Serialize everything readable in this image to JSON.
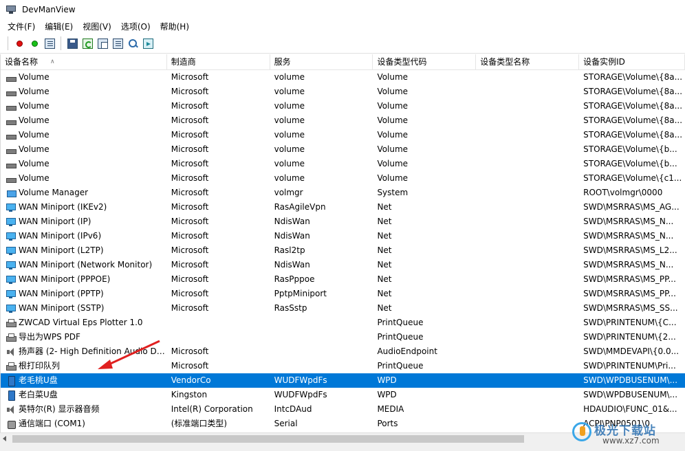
{
  "window": {
    "title": "DevManView"
  },
  "menu": [
    "文件(F)",
    "编辑(E)",
    "视图(V)",
    "选项(O)",
    "帮助(H)"
  ],
  "columns": [
    "设备名称",
    "制造商",
    "服务",
    "设备类型代码",
    "设备类型名称",
    "设备实例ID"
  ],
  "rows": [
    {
      "icon": "drive-icon",
      "name": "Volume",
      "manufacturer": "Microsoft",
      "service": "volume",
      "class": "Volume",
      "class_name": "",
      "instance_id": "STORAGE\\Volume\\{8a..."
    },
    {
      "icon": "drive-icon",
      "name": "Volume",
      "manufacturer": "Microsoft",
      "service": "volume",
      "class": "Volume",
      "class_name": "",
      "instance_id": "STORAGE\\Volume\\{8a..."
    },
    {
      "icon": "drive-icon",
      "name": "Volume",
      "manufacturer": "Microsoft",
      "service": "volume",
      "class": "Volume",
      "class_name": "",
      "instance_id": "STORAGE\\Volume\\{8a..."
    },
    {
      "icon": "drive-icon",
      "name": "Volume",
      "manufacturer": "Microsoft",
      "service": "volume",
      "class": "Volume",
      "class_name": "",
      "instance_id": "STORAGE\\Volume\\{8a..."
    },
    {
      "icon": "drive-icon",
      "name": "Volume",
      "manufacturer": "Microsoft",
      "service": "volume",
      "class": "Volume",
      "class_name": "",
      "instance_id": "STORAGE\\Volume\\{8a..."
    },
    {
      "icon": "drive-icon",
      "name": "Volume",
      "manufacturer": "Microsoft",
      "service": "volume",
      "class": "Volume",
      "class_name": "",
      "instance_id": "STORAGE\\Volume\\{b..."
    },
    {
      "icon": "drive-icon",
      "name": "Volume",
      "manufacturer": "Microsoft",
      "service": "volume",
      "class": "Volume",
      "class_name": "",
      "instance_id": "STORAGE\\Volume\\{b..."
    },
    {
      "icon": "drive-icon",
      "name": "Volume",
      "manufacturer": "Microsoft",
      "service": "volume",
      "class": "Volume",
      "class_name": "",
      "instance_id": "STORAGE\\Volume\\{c1..."
    },
    {
      "icon": "system-device-icon",
      "name": "Volume Manager",
      "manufacturer": "Microsoft",
      "service": "volmgr",
      "class": "System",
      "class_name": "",
      "instance_id": "ROOT\\volmgr\\0000"
    },
    {
      "icon": "network-adapter-icon",
      "name": "WAN Miniport (IKEv2)",
      "manufacturer": "Microsoft",
      "service": "RasAgileVpn",
      "class": "Net",
      "class_name": "",
      "instance_id": "SWD\\MSRRAS\\MS_AG..."
    },
    {
      "icon": "network-adapter-icon",
      "name": "WAN Miniport (IP)",
      "manufacturer": "Microsoft",
      "service": "NdisWan",
      "class": "Net",
      "class_name": "",
      "instance_id": "SWD\\MSRRAS\\MS_N..."
    },
    {
      "icon": "network-adapter-icon",
      "name": "WAN Miniport (IPv6)",
      "manufacturer": "Microsoft",
      "service": "NdisWan",
      "class": "Net",
      "class_name": "",
      "instance_id": "SWD\\MSRRAS\\MS_N..."
    },
    {
      "icon": "network-adapter-icon",
      "name": "WAN Miniport (L2TP)",
      "manufacturer": "Microsoft",
      "service": "Rasl2tp",
      "class": "Net",
      "class_name": "",
      "instance_id": "SWD\\MSRRAS\\MS_L2..."
    },
    {
      "icon": "network-adapter-icon",
      "name": "WAN Miniport (Network Monitor)",
      "manufacturer": "Microsoft",
      "service": "NdisWan",
      "class": "Net",
      "class_name": "",
      "instance_id": "SWD\\MSRRAS\\MS_N..."
    },
    {
      "icon": "network-adapter-icon",
      "name": "WAN Miniport (PPPOE)",
      "manufacturer": "Microsoft",
      "service": "RasPppoe",
      "class": "Net",
      "class_name": "",
      "instance_id": "SWD\\MSRRAS\\MS_PP..."
    },
    {
      "icon": "network-adapter-icon",
      "name": "WAN Miniport (PPTP)",
      "manufacturer": "Microsoft",
      "service": "PptpMiniport",
      "class": "Net",
      "class_name": "",
      "instance_id": "SWD\\MSRRAS\\MS_PP..."
    },
    {
      "icon": "network-adapter-icon",
      "name": "WAN Miniport (SSTP)",
      "manufacturer": "Microsoft",
      "service": "RasSstp",
      "class": "Net",
      "class_name": "",
      "instance_id": "SWD\\MSRRAS\\MS_SS..."
    },
    {
      "icon": "printer-icon",
      "name": "ZWCAD Virtual Eps Plotter 1.0",
      "manufacturer": "",
      "service": "",
      "class": "PrintQueue",
      "class_name": "",
      "instance_id": "SWD\\PRINTENUM\\{C..."
    },
    {
      "icon": "printer-icon",
      "name": "导出为WPS PDF",
      "manufacturer": "",
      "service": "",
      "class": "PrintQueue",
      "class_name": "",
      "instance_id": "SWD\\PRINTENUM\\{2..."
    },
    {
      "icon": "speaker-icon",
      "name": "扬声器 (2- High Definition Audio De...",
      "manufacturer": "Microsoft",
      "service": "",
      "class": "AudioEndpoint",
      "class_name": "",
      "instance_id": "SWD\\MMDEVAPI\\{0.0..."
    },
    {
      "icon": "printer-icon",
      "name": "根打印队列",
      "manufacturer": "Microsoft",
      "service": "",
      "class": "PrintQueue",
      "class_name": "",
      "instance_id": "SWD\\PRINTENUM\\Pri..."
    },
    {
      "icon": "portable-device-icon",
      "name": "老毛桃U盘",
      "manufacturer": "VendorCo",
      "service": "WUDFWpdFs",
      "class": "WPD",
      "class_name": "",
      "instance_id": "SWD\\WPDBUSENUM\\...",
      "selected": true
    },
    {
      "icon": "portable-device-icon",
      "name": "老白菜U盘",
      "manufacturer": "Kingston",
      "service": "WUDFWpdFs",
      "class": "WPD",
      "class_name": "",
      "instance_id": "SWD\\WPDBUSENUM\\..."
    },
    {
      "icon": "speaker-icon",
      "name": "英特尔(R) 显示器音频",
      "manufacturer": "Intel(R) Corporation",
      "service": "IntcDAud",
      "class": "MEDIA",
      "class_name": "",
      "instance_id": "HDAUDIO\\FUNC_01&..."
    },
    {
      "icon": "port-icon",
      "name": "通信端口 (COM1)",
      "manufacturer": "(标准端口类型)",
      "service": "Serial",
      "class": "Ports",
      "class_name": "",
      "instance_id": "ACPI\\PNP0501\\0"
    }
  ],
  "colors": {
    "selection": "#0078d7",
    "annotation_arrow": "#e02020"
  },
  "watermark": {
    "text": "极光下载站",
    "url": "www.xz7.com"
  }
}
